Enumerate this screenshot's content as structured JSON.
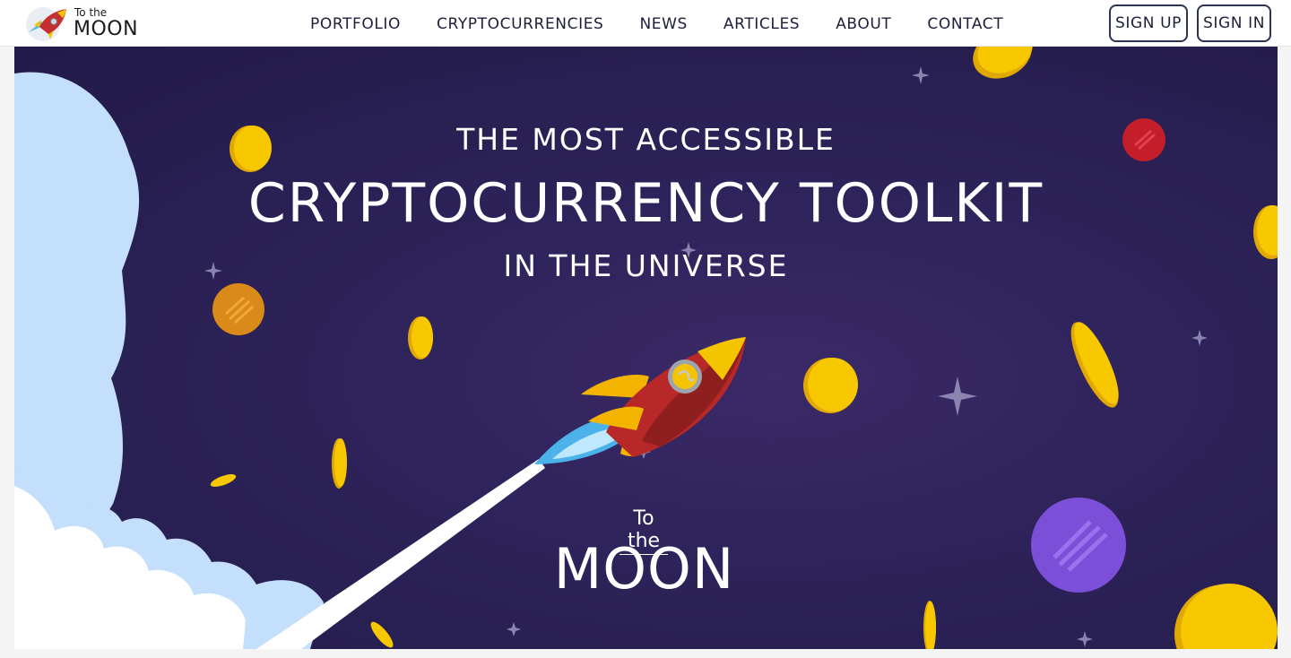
{
  "logo": {
    "line1": "To the",
    "line2": "MOON"
  },
  "nav": {
    "links": [
      "PORTFOLIO",
      "CRYPTOCURRENCIES",
      "NEWS",
      "ARTICLES",
      "ABOUT",
      "CONTACT"
    ],
    "sign_up": "SIGN UP",
    "sign_in": "SIGN IN"
  },
  "hero": {
    "line1": "THE MOST ACCESSIBLE",
    "line2": "CRYPTOCURRENCY TOOLKIT",
    "line3": "IN THE UNIVERSE",
    "brand_small": "To the",
    "brand_big": "MOON"
  },
  "colors": {
    "background": "#2c2258",
    "coin": "#f5c400",
    "cloud": "#c3dffb",
    "rocket_body": "#c62f2f",
    "planet_purple": "#7b4fd8",
    "planet_orange": "#d98a18",
    "planet_red": "#c41e2a"
  },
  "icons": [
    "rocket-logo-icon",
    "rocket-icon",
    "coin-icon",
    "planet-icon",
    "star-icon",
    "cloud-icon"
  ]
}
